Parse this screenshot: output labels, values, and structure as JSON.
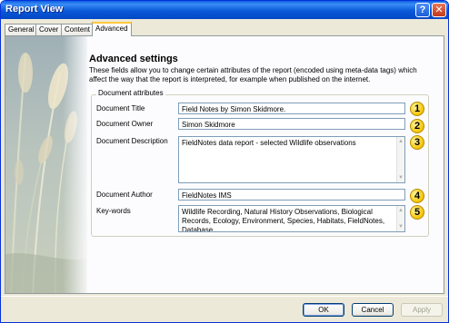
{
  "window": {
    "title": "Report View",
    "help_icon": "question-mark-icon",
    "close_icon": "close-x-icon"
  },
  "tabs": [
    {
      "label": "General"
    },
    {
      "label": "Cover"
    },
    {
      "label": "Content"
    },
    {
      "label": "Advanced",
      "active": true
    }
  ],
  "panel": {
    "heading": "Advanced settings",
    "description": "These fields allow you to change certain attributes of the report (encoded using meta-data tags) which affect the way that the report is interpreted, for example when published on the internet.",
    "group_label": "Document attributes",
    "fields": {
      "title": {
        "label": "Document Title",
        "value": "Field Notes by Simon Skidmore."
      },
      "owner": {
        "label": "Document Owner",
        "value": "Simon Skidmore"
      },
      "description": {
        "label": "Document Description",
        "value": "FieldNotes data report - selected Wildlife observations"
      },
      "author": {
        "label": "Document Author",
        "value": "FieldNotes IMS"
      },
      "keywords": {
        "label": "Key-words",
        "value": "Wildlife Recording, Natural History Observations, Biological Records, Ecology, Environment, Species, Habitats, FieldNotes, Database"
      }
    },
    "callouts": [
      "1",
      "2",
      "3",
      "4",
      "5"
    ]
  },
  "buttons": {
    "ok": "OK",
    "cancel": "Cancel",
    "apply": "Apply"
  },
  "colors": {
    "titlebar": "#0a58d8",
    "callout": "#f5c400",
    "dialog_bg": "#ece9d8"
  }
}
